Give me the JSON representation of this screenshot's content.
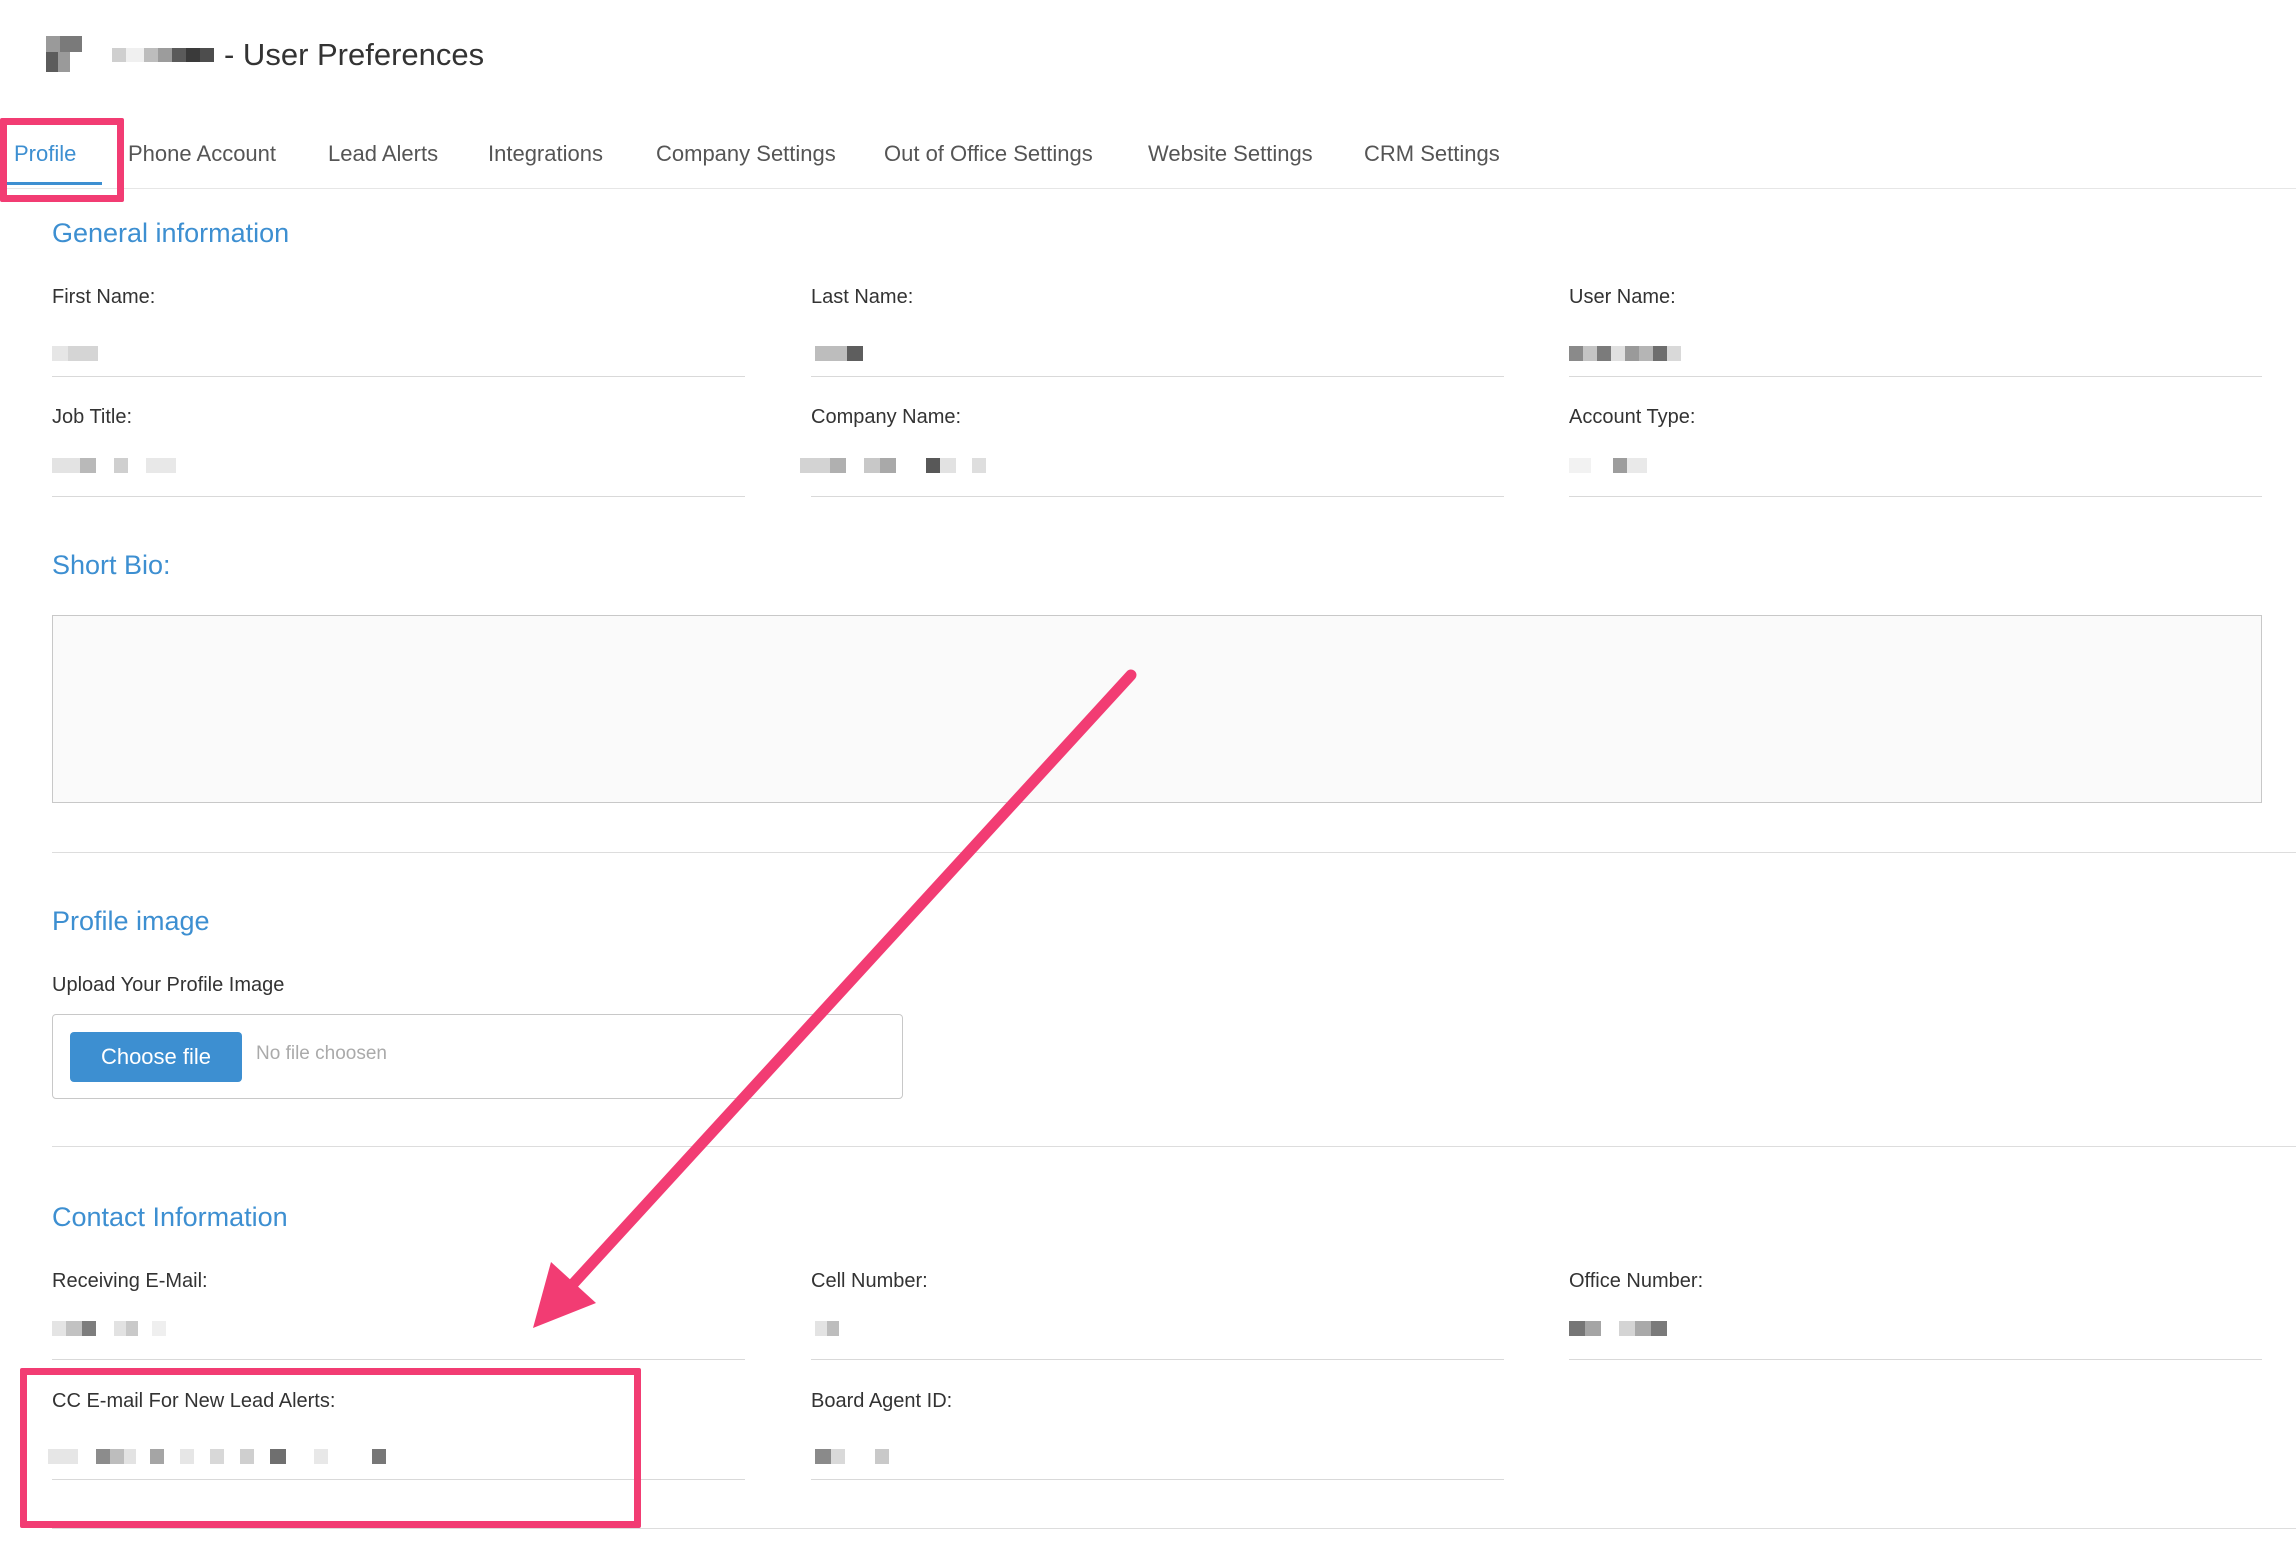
{
  "header": {
    "title": "- User Preferences"
  },
  "tabs": [
    {
      "label": "Profile",
      "active": true
    },
    {
      "label": "Phone Account"
    },
    {
      "label": "Lead Alerts"
    },
    {
      "label": "Integrations"
    },
    {
      "label": "Company Settings"
    },
    {
      "label": "Out of Office Settings"
    },
    {
      "label": "Website Settings"
    },
    {
      "label": "CRM Settings"
    }
  ],
  "general": {
    "title": "General information",
    "first_name_label": "First Name:",
    "last_name_label": "Last Name:",
    "user_name_label": "User Name:",
    "job_title_label": "Job Title:",
    "company_name_label": "Company Name:",
    "account_type_label": "Account Type:"
  },
  "bio": {
    "title": "Short Bio:"
  },
  "profile_image": {
    "title": "Profile image",
    "upload_label": "Upload Your Profile Image",
    "choose_button": "Choose file",
    "no_file": "No file choosen"
  },
  "contact": {
    "title": "Contact Information",
    "receiving_email_label": "Receiving E-Mail:",
    "cell_number_label": "Cell Number:",
    "office_number_label": "Office Number:",
    "cc_email_label": "CC E-mail For New Lead Alerts:",
    "board_agent_id_label": "Board Agent ID:"
  },
  "colors": {
    "accent": "#3d8fd1",
    "highlight": "#f23c73"
  }
}
